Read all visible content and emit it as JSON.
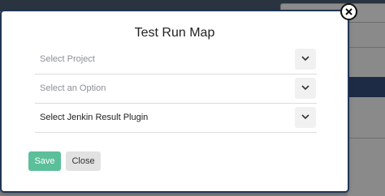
{
  "modal": {
    "title": "Test Run Map",
    "selects": [
      {
        "placeholder": "Select Project",
        "value": ""
      },
      {
        "placeholder": "Select an Option",
        "value": ""
      },
      {
        "placeholder": "",
        "value": "Select Jenkin Result Plugin"
      }
    ],
    "save_label": "Save",
    "close_label": "Close"
  },
  "icons": {
    "close": "close-icon",
    "chevron": "chevron-down-icon"
  },
  "colors": {
    "save_button": "#5bbf9a",
    "close_button": "#e2e2e2",
    "modal_border": "#1f3556"
  }
}
